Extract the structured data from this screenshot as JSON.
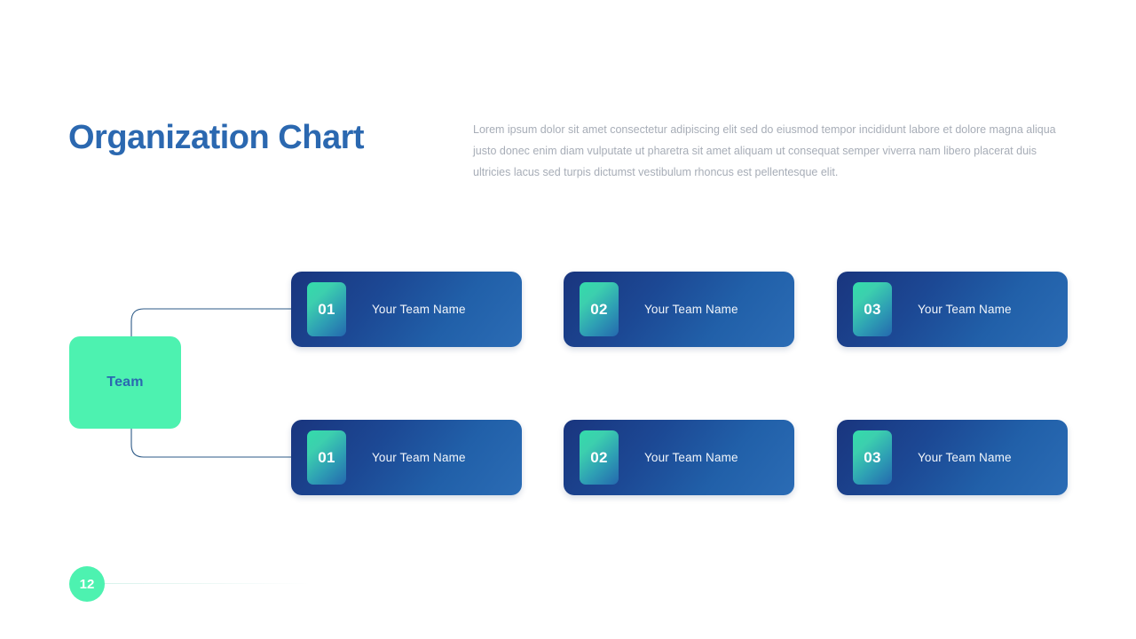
{
  "slide": {
    "title": "Organization Chart",
    "paragraph": "Lorem ipsum dolor sit amet consectetur adipiscing elit sed do eiusmod tempor incididunt labore et dolore magna aliqua justo donec enim diam vulputate ut pharetra sit amet aliquam ut consequat semper viverra nam libero placerat duis ultricies lacus sed turpis dictumst vestibulum rhoncus est pellentesque elit.",
    "page_number": "12"
  },
  "root_node": {
    "label": "Team"
  },
  "cards": {
    "top": [
      {
        "number": "01",
        "label": "Your Team Name"
      },
      {
        "number": "02",
        "label": "Your Team Name"
      },
      {
        "number": "03",
        "label": "Your Team Name"
      }
    ],
    "bottom": [
      {
        "number": "01",
        "label": "Your Team Name"
      },
      {
        "number": "02",
        "label": "Your Team Name"
      },
      {
        "number": "03",
        "label": "Your Team Name"
      }
    ]
  },
  "colors": {
    "title_blue": "#2b68b0",
    "mint": "#4df2b0",
    "card_navy": "#19357e",
    "card_blue": "#2b6cb5",
    "badge_teal": "#33dcaa",
    "paragraph_gray": "#a7adb7",
    "connector_line": "#2d5a87"
  }
}
